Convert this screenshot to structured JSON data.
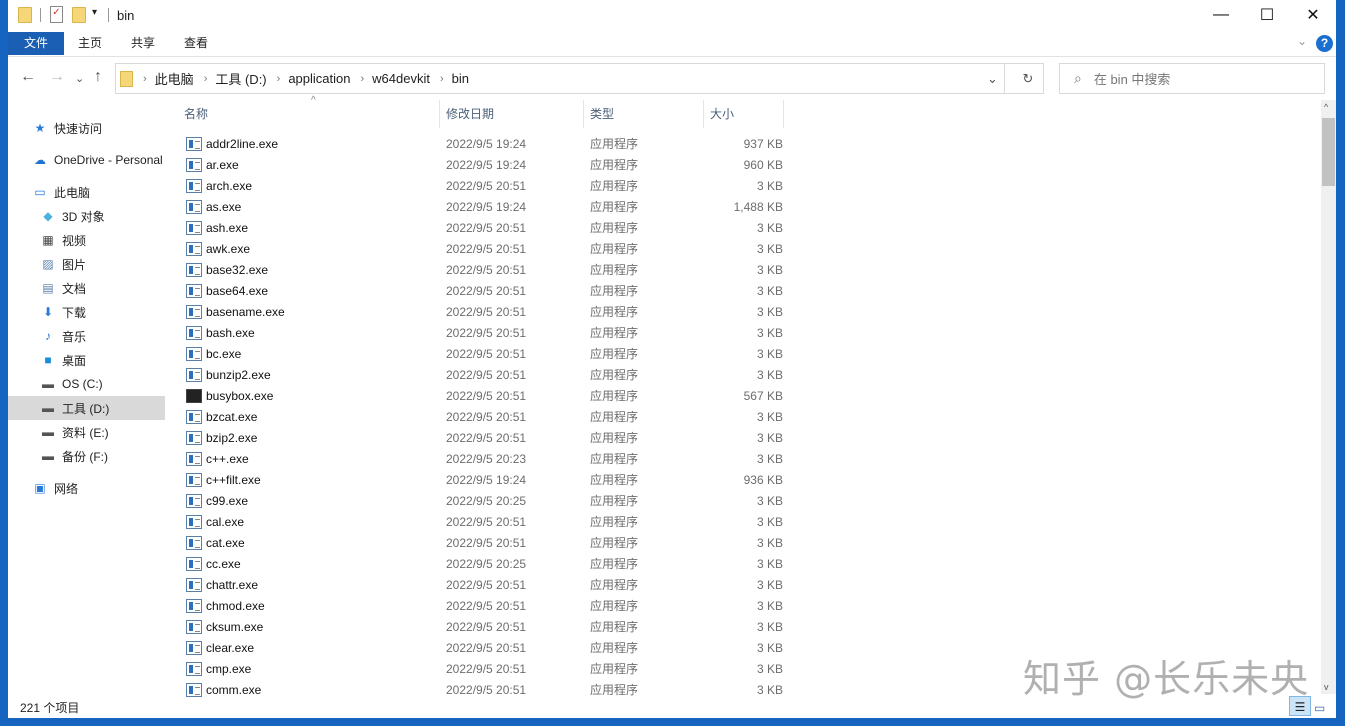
{
  "window": {
    "title": "bin",
    "minimize": "—",
    "maximize": "☐",
    "close": "✕"
  },
  "ribbon": {
    "tabs": [
      "文件",
      "主页",
      "共享",
      "查看"
    ],
    "expand": "⌄",
    "help": "?"
  },
  "address": {
    "crumbs": [
      "此电脑",
      "工具 (D:)",
      "application",
      "w64devkit",
      "bin"
    ],
    "refresh": "↻",
    "dropdown": "⌄"
  },
  "nav": {
    "back": "←",
    "forward": "→",
    "recent": "⌄",
    "up": "↑"
  },
  "search": {
    "placeholder": "在 bin 中搜索",
    "icon": "⌕"
  },
  "sidebar": {
    "items": [
      {
        "label": "快速访问",
        "icon": "★",
        "color": "#2a7ad8"
      },
      {
        "label": "OneDrive - Personal",
        "icon": "☁",
        "color": "#1f73d0"
      },
      {
        "label": "此电脑",
        "icon": "▭",
        "color": "#2a7ad8"
      },
      {
        "label": "3D 对象",
        "icon": "◆",
        "color": "#4ab0e0"
      },
      {
        "label": "视频",
        "icon": "▦",
        "color": "#444"
      },
      {
        "label": "图片",
        "icon": "▨",
        "color": "#5a7fa8"
      },
      {
        "label": "文档",
        "icon": "▤",
        "color": "#5a7fa8"
      },
      {
        "label": "下载",
        "icon": "⬇",
        "color": "#2a7ad8"
      },
      {
        "label": "音乐",
        "icon": "♪",
        "color": "#2a7ad8"
      },
      {
        "label": "桌面",
        "icon": "■",
        "color": "#1a8fd8"
      },
      {
        "label": "OS (C:)",
        "icon": "▬",
        "color": "#555"
      },
      {
        "label": "工具 (D:)",
        "icon": "▬",
        "color": "#555"
      },
      {
        "label": "资料 (E:)",
        "icon": "▬",
        "color": "#555"
      },
      {
        "label": "备份 (F:)",
        "icon": "▬",
        "color": "#555"
      },
      {
        "label": "网络",
        "icon": "▣",
        "color": "#2a7ad8"
      }
    ]
  },
  "columns": {
    "name": "名称",
    "date": "修改日期",
    "type": "类型",
    "size": "大小"
  },
  "files": [
    [
      "addr2line.exe",
      "2022/9/5 19:24",
      "应用程序",
      "937 KB"
    ],
    [
      "ar.exe",
      "2022/9/5 19:24",
      "应用程序",
      "960 KB"
    ],
    [
      "arch.exe",
      "2022/9/5 20:51",
      "应用程序",
      "3 KB"
    ],
    [
      "as.exe",
      "2022/9/5 19:24",
      "应用程序",
      "1,488 KB"
    ],
    [
      "ash.exe",
      "2022/9/5 20:51",
      "应用程序",
      "3 KB"
    ],
    [
      "awk.exe",
      "2022/9/5 20:51",
      "应用程序",
      "3 KB"
    ],
    [
      "base32.exe",
      "2022/9/5 20:51",
      "应用程序",
      "3 KB"
    ],
    [
      "base64.exe",
      "2022/9/5 20:51",
      "应用程序",
      "3 KB"
    ],
    [
      "basename.exe",
      "2022/9/5 20:51",
      "应用程序",
      "3 KB"
    ],
    [
      "bash.exe",
      "2022/9/5 20:51",
      "应用程序",
      "3 KB"
    ],
    [
      "bc.exe",
      "2022/9/5 20:51",
      "应用程序",
      "3 KB"
    ],
    [
      "bunzip2.exe",
      "2022/9/5 20:51",
      "应用程序",
      "3 KB"
    ],
    [
      "busybox.exe",
      "2022/9/5 20:51",
      "应用程序",
      "567 KB"
    ],
    [
      "bzcat.exe",
      "2022/9/5 20:51",
      "应用程序",
      "3 KB"
    ],
    [
      "bzip2.exe",
      "2022/9/5 20:51",
      "应用程序",
      "3 KB"
    ],
    [
      "c++.exe",
      "2022/9/5 20:23",
      "应用程序",
      "3 KB"
    ],
    [
      "c++filt.exe",
      "2022/9/5 19:24",
      "应用程序",
      "936 KB"
    ],
    [
      "c99.exe",
      "2022/9/5 20:25",
      "应用程序",
      "3 KB"
    ],
    [
      "cal.exe",
      "2022/9/5 20:51",
      "应用程序",
      "3 KB"
    ],
    [
      "cat.exe",
      "2022/9/5 20:51",
      "应用程序",
      "3 KB"
    ],
    [
      "cc.exe",
      "2022/9/5 20:25",
      "应用程序",
      "3 KB"
    ],
    [
      "chattr.exe",
      "2022/9/5 20:51",
      "应用程序",
      "3 KB"
    ],
    [
      "chmod.exe",
      "2022/9/5 20:51",
      "应用程序",
      "3 KB"
    ],
    [
      "cksum.exe",
      "2022/9/5 20:51",
      "应用程序",
      "3 KB"
    ],
    [
      "clear.exe",
      "2022/9/5 20:51",
      "应用程序",
      "3 KB"
    ],
    [
      "cmp.exe",
      "2022/9/5 20:51",
      "应用程序",
      "3 KB"
    ],
    [
      "comm.exe",
      "2022/9/5 20:51",
      "应用程序",
      "3 KB"
    ]
  ],
  "status": {
    "count": "221 个项目"
  },
  "watermark": "知乎 @长乐未央"
}
